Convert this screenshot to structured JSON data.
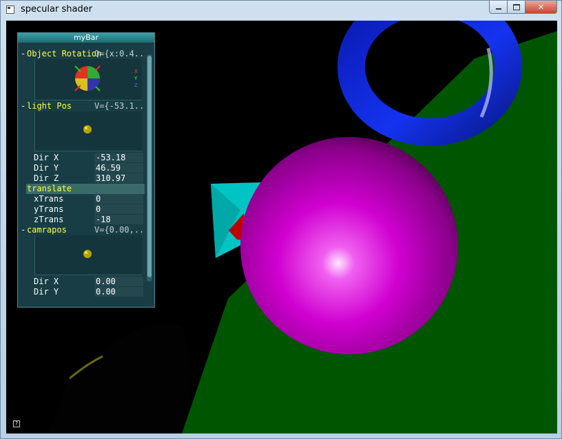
{
  "window": {
    "title": "specular shader"
  },
  "bar": {
    "title": "myBar",
    "groups": {
      "object_rotation": {
        "label": "Object Rotation",
        "value": "Q={x:0.4.."
      },
      "light_pos": {
        "label": "light Pos",
        "value": "V={-53.1.."
      },
      "translate": {
        "label": "translate"
      },
      "camrapos": {
        "label": "camrapos",
        "value": "V={0.00,.."
      }
    },
    "rows": [
      {
        "label": "Dir X",
        "value": "-53.18"
      },
      {
        "label": "Dir Y",
        "value": "46.59"
      },
      {
        "label": "Dir Z",
        "value": "310.97"
      },
      {
        "label": "xTrans",
        "value": "0"
      },
      {
        "label": "yTrans",
        "value": "0"
      },
      {
        "label": "zTrans",
        "value": "-18"
      },
      {
        "label": "Dir X",
        "value": "0.00"
      },
      {
        "label": "Dir Y",
        "value": "0.00"
      }
    ],
    "axis_labels": {
      "x": "X",
      "y": "Y",
      "z": "Z"
    },
    "help_label": "?"
  },
  "colors": {
    "sphere": "#d000d0",
    "torus": "#1028e0",
    "floor": "#005500",
    "cube": "#00c8c8",
    "cone": "#b00000",
    "bar_bg": "#1a424a",
    "group_label": "#ffff40"
  },
  "icons": {
    "close": "close-icon",
    "maximize": "maximize-icon",
    "minimize": "minimize-icon",
    "rotation": "rotation-gizmo-icon",
    "light": "light-dot-icon"
  }
}
